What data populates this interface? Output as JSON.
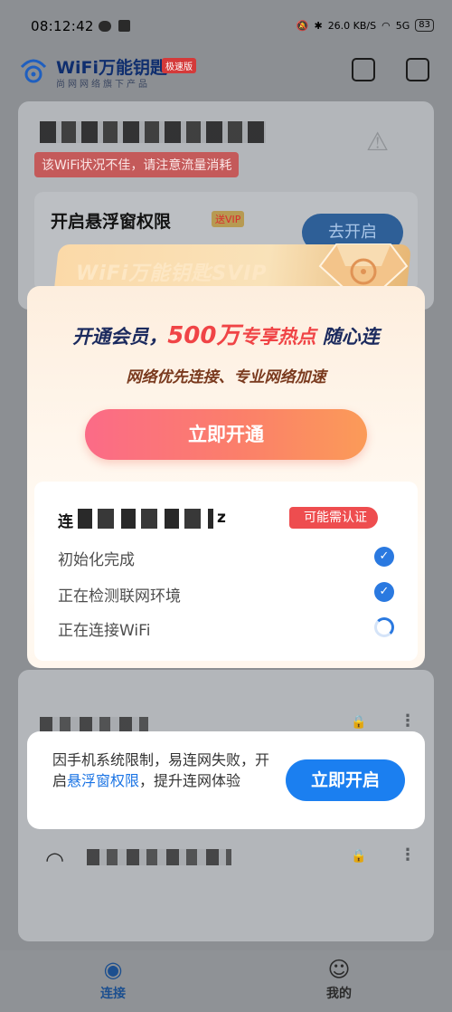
{
  "status_bar": {
    "time": "08:12:42",
    "net_speed": "26.0 KB/S",
    "signal": "5G",
    "battery": "83"
  },
  "header": {
    "brand": "WiFi万能钥匙",
    "badge": "极速版",
    "subtitle": "尚网网络旗下产品"
  },
  "network_card": {
    "warning": "该WiFi状况不佳，请注意流量消耗",
    "float_permission_title": "开启悬浮窗权限",
    "vip_tag": "送VIP",
    "open_button": "去开启"
  },
  "vip_popup": {
    "ribbon": "WiFi万能钥匙SVIP",
    "line1_prefix": "开通会员，",
    "line1_highlight": "500万",
    "line1_middle": "专享热点",
    "line1_suffix": " 随心连",
    "line2": "网络优先连接、专业网络加速",
    "cta": "立即开通",
    "connecting_prefix": "连",
    "connecting_suffix": "z",
    "auth_tag": "可能需认证",
    "steps": [
      {
        "label": "初始化完成",
        "state": "done"
      },
      {
        "label": "正在检测联网环境",
        "state": "done"
      },
      {
        "label": "正在连接WiFi",
        "state": "loading"
      }
    ]
  },
  "toast": {
    "text_before": "因手机系统限制，易连网失败，开启",
    "link": "悬浮窗权限",
    "text_after": "，提升连网体验",
    "button": "立即开启"
  },
  "tabbar": {
    "tabs": [
      {
        "label": "连接",
        "active": true
      },
      {
        "label": "我的",
        "active": false
      }
    ]
  },
  "colors": {
    "accent_blue": "#1b7ff0",
    "vip_red": "#f04446",
    "auth_red": "#ee4d4f"
  }
}
